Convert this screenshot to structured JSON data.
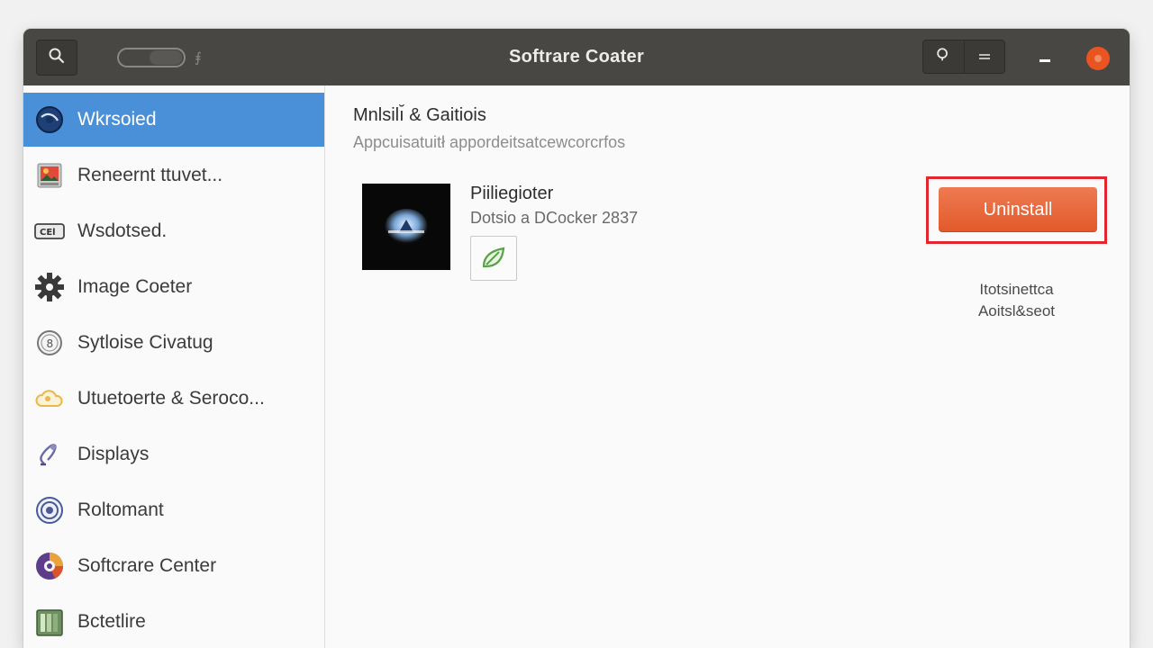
{
  "window": {
    "title": "Softrare Coater"
  },
  "titlebar": {
    "search_icon": "search-icon",
    "toggle_glyph": "⨎",
    "right_icons": [
      "search-icon",
      "hamburger-menu-icon"
    ],
    "minimize_icon": "minimize-icon",
    "close_icon": "close-icon"
  },
  "sidebar": {
    "items": [
      {
        "label": "Wkrsoied",
        "icon": "globe-icon",
        "active": true
      },
      {
        "label": "Reneernt ttuvet...",
        "icon": "photo-icon",
        "active": false
      },
      {
        "label": "Wsdotsed.",
        "icon": "card-icon",
        "active": false
      },
      {
        "label": "Image Coeter",
        "icon": "gear-icon",
        "active": false
      },
      {
        "label": "Sytloise Civatug",
        "icon": "info-icon",
        "active": false
      },
      {
        "label": "Utuetoerte & Seroco...",
        "icon": "cloud-icon",
        "active": false
      },
      {
        "label": "Displays",
        "icon": "display-icon",
        "active": false
      },
      {
        "label": "Roltomant",
        "icon": "privacy-icon",
        "active": false
      },
      {
        "label": "Softcrare Center",
        "icon": "software-center-icon",
        "active": false
      },
      {
        "label": "Bctetlire",
        "icon": "battery-icon",
        "active": false
      }
    ]
  },
  "main": {
    "section_title": "Mnlsilı̆ & Gaitiois",
    "section_subtitle": "Appcuisatuitł appordeitsatcewcorcrfos",
    "app": {
      "name": "Piiliegioter",
      "meta": "Dotsio a DCocker 2837",
      "thumbnail_icon": "app-thumbnail-icon",
      "badge_icon": "leaf-badge-icon"
    },
    "action": {
      "button_label": "Uninstall",
      "note_line1": "Itotsinettca",
      "note_line2": "Aoitsl&seot"
    }
  },
  "colors": {
    "titlebar": "#494743",
    "accent_selected": "#4a90d9",
    "uninstall_button": "#e85d2c",
    "highlight_border": "#e2262f",
    "close_button": "#e95420"
  }
}
